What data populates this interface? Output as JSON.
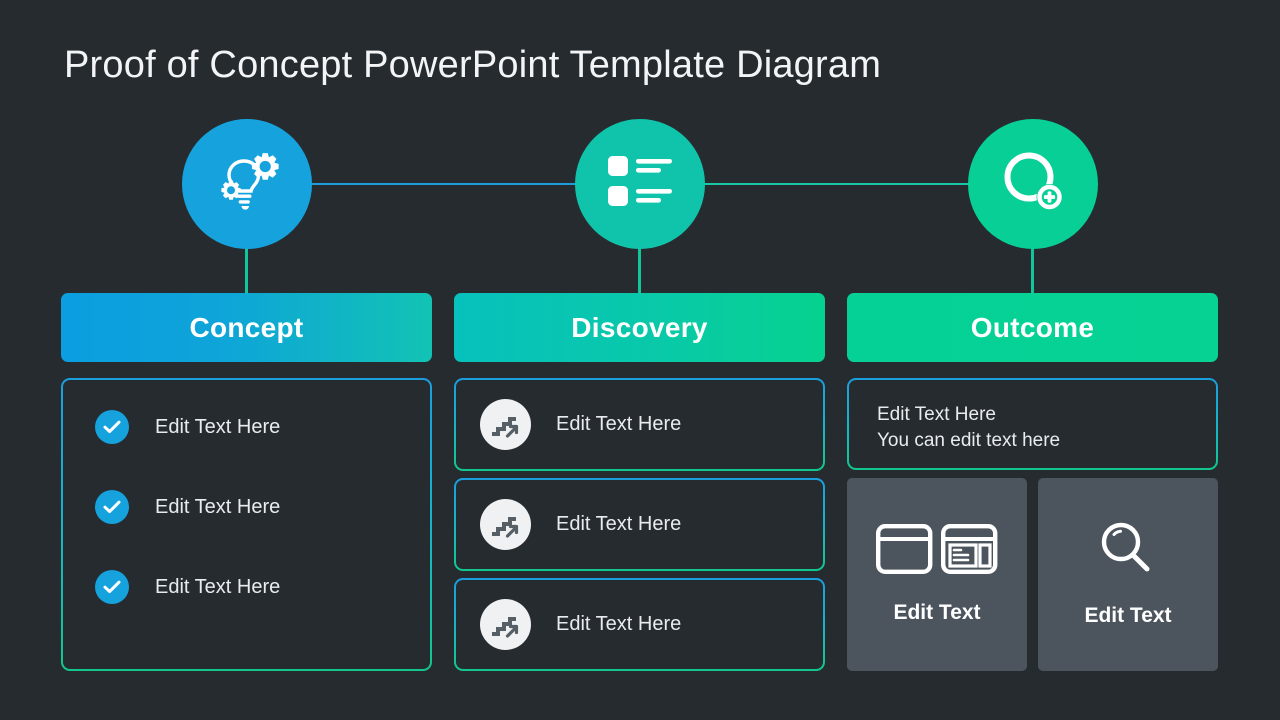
{
  "slide": {
    "title": "Proof of Concept PowerPoint Template Diagram",
    "background_color": "#262b30"
  },
  "colors": {
    "concept_blue": "#16a3dd",
    "discovery_teal": "#10c4ab",
    "outcome_green": "#07cf96",
    "tile_grey": "#4c555e",
    "text_light": "#e9ecee"
  },
  "columns": [
    {
      "id": "concept",
      "header_label": "Concept",
      "icon": "lightbulb-gears-icon",
      "circle_color": "#16a3dd",
      "items": [
        {
          "icon": "check-circle-icon",
          "label": "Edit Text Here"
        },
        {
          "icon": "check-circle-icon",
          "label": "Edit Text Here"
        },
        {
          "icon": "check-circle-icon",
          "label": "Edit Text Here"
        }
      ]
    },
    {
      "id": "discovery",
      "header_label": "Discovery",
      "icon": "list-items-icon",
      "circle_color": "#10c4ab",
      "items": [
        {
          "icon": "stairs-arrow-icon",
          "label": "Edit Text Here"
        },
        {
          "icon": "stairs-arrow-icon",
          "label": "Edit Text Here"
        },
        {
          "icon": "stairs-arrow-icon",
          "label": "Edit Text Here"
        }
      ]
    },
    {
      "id": "outcome",
      "header_label": "Outcome",
      "icon": "circle-plus-icon",
      "circle_color": "#07cf96",
      "textbox": {
        "line1": "Edit Text Here",
        "line2": "You can edit text here"
      },
      "tiles": [
        {
          "icon": "browser-layout-icon",
          "label": "Edit Text"
        },
        {
          "icon": "magnifier-icon",
          "label": "Edit Text"
        }
      ]
    }
  ]
}
